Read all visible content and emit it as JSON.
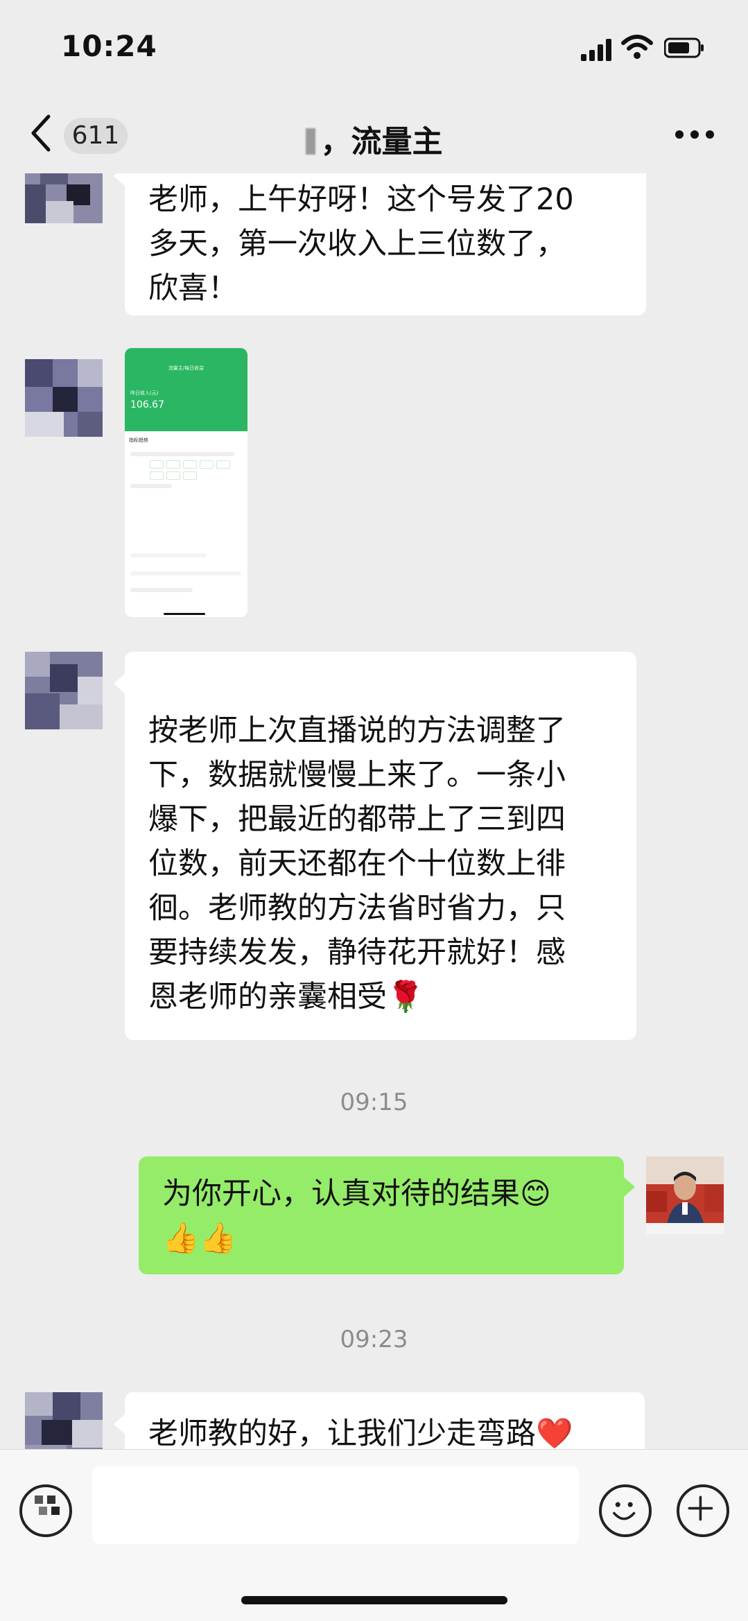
{
  "status_bar": {
    "time": "10:24"
  },
  "nav": {
    "unread_count": "611",
    "title": "，流量主",
    "more_icon": "more-dots-icon",
    "back_icon": "chevron-left-icon"
  },
  "messages": [
    {
      "side": "left",
      "text": "老师，上午好呀！这个号发了20\n多天，第一次收入上三位数了，\n欣喜！"
    },
    {
      "side": "left",
      "type": "image",
      "thumb": {
        "title": "流量主/每日收益",
        "income_label": "昨日收入(元)",
        "income": "106.67",
        "section": "指标趋势"
      }
    },
    {
      "side": "left",
      "text": "按老师上次直播说的方法调整了\n下，数据就慢慢上来了。一条小\n爆下，把最近的都带上了三到四\n位数，前天还都在个十位数上徘\n徊。老师教的方法省时省力，只\n要持续发发，静待花开就好！感\n恩老师的亲囊相受🌹"
    },
    {
      "side": "time",
      "text": "09:15"
    },
    {
      "side": "right",
      "text": "为你开心，认真对待的结果😊\n👍👍"
    },
    {
      "side": "time",
      "text": "09:23"
    },
    {
      "side": "left",
      "text": "老师教的好，让我们少走弯路❤️"
    }
  ],
  "input_bar": {
    "voice_icon": "voice-icon",
    "emoji_icon": "emoji-smile-icon",
    "plus_icon": "plus-circle-icon"
  },
  "colors": {
    "background": "#ededed",
    "incoming": "#ffffff",
    "outgoing": "#95ec69"
  }
}
